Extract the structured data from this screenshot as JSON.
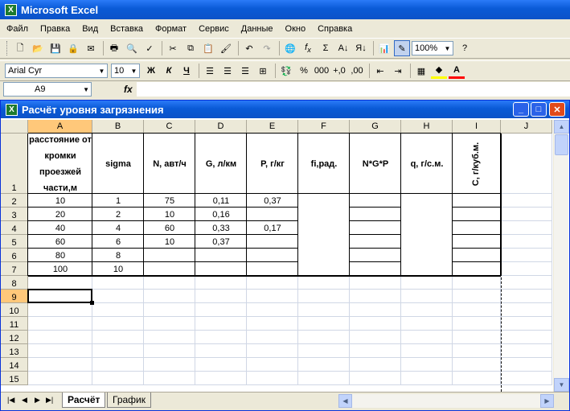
{
  "app": {
    "title": "Microsoft Excel",
    "icon": "excel-icon"
  },
  "menu": [
    "Файл",
    "Правка",
    "Вид",
    "Вставка",
    "Формат",
    "Сервис",
    "Данные",
    "Окно",
    "Справка"
  ],
  "toolbar": {
    "zoom": "100%",
    "font_name": "Arial Cyr",
    "font_size": "10"
  },
  "formula_bar": {
    "cell_ref": "A9",
    "fx": "fx",
    "content": ""
  },
  "workbook": {
    "title": "Расчёт уровня загрязнения"
  },
  "columns": [
    "A",
    "B",
    "C",
    "D",
    "E",
    "F",
    "G",
    "H",
    "I",
    "J"
  ],
  "rows": [
    "1",
    "2",
    "3",
    "4",
    "5",
    "6",
    "7",
    "8",
    "9",
    "10",
    "11",
    "12",
    "13",
    "14",
    "15"
  ],
  "headers": {
    "A": "расстояние от кромки проезжей части,м",
    "B": "sigma",
    "C": "N, авт/ч",
    "D": "G, л/км",
    "E": "P, г/кг",
    "F": "fi,рад.",
    "G": "N*G*P",
    "H": "q, г/с.м.",
    "I": "C, г/куб.м."
  },
  "table": {
    "A": [
      "10",
      "20",
      "40",
      "60",
      "80",
      "100"
    ],
    "B": [
      "1",
      "2",
      "4",
      "6",
      "8",
      "10"
    ],
    "C": [
      "75",
      "10",
      "60",
      "10",
      "",
      ""
    ],
    "D": [
      "0,11",
      "0,16",
      "0,33",
      "0,37",
      "",
      ""
    ],
    "E": [
      "0,37",
      "",
      "0,17",
      "",
      "",
      ""
    ]
  },
  "sheets": [
    {
      "name": "Расчёт",
      "active": true
    },
    {
      "name": "График",
      "active": false
    }
  ]
}
